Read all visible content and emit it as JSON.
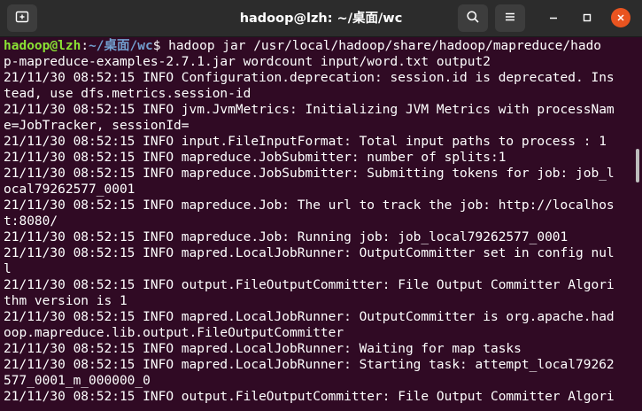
{
  "window": {
    "title": "hadoop@lzh: ~/桌面/wc",
    "icons": {
      "new_tab": "new-tab-icon",
      "search": "search-icon",
      "menu": "hamburger-menu-icon",
      "minimize": "minimize-icon",
      "maximize": "maximize-icon",
      "close": "close-icon"
    }
  },
  "prompt": {
    "user_host": "hadoop@lzh",
    "separator": ":",
    "path": "~/桌面/wc",
    "symbol": "$"
  },
  "command": {
    "first": " hadoop jar /usr/local/hadoop/share/hadoop/mapreduce/hado",
    "continuation": "p-mapreduce-examples-2.7.1.jar wordcount input/word.txt output2"
  },
  "output_lines": [
    "21/11/30 08:52:15 INFO Configuration.deprecation: session.id is deprecated. Ins",
    "tead, use dfs.metrics.session-id",
    "21/11/30 08:52:15 INFO jvm.JvmMetrics: Initializing JVM Metrics with processNam",
    "e=JobTracker, sessionId=",
    "21/11/30 08:52:15 INFO input.FileInputFormat: Total input paths to process : 1",
    "21/11/30 08:52:15 INFO mapreduce.JobSubmitter: number of splits:1",
    "21/11/30 08:52:15 INFO mapreduce.JobSubmitter: Submitting tokens for job: job_l",
    "ocal79262577_0001",
    "21/11/30 08:52:15 INFO mapreduce.Job: The url to track the job: http://localhos",
    "t:8080/",
    "21/11/30 08:52:15 INFO mapreduce.Job: Running job: job_local79262577_0001",
    "21/11/30 08:52:15 INFO mapred.LocalJobRunner: OutputCommitter set in config nul",
    "l",
    "21/11/30 08:52:15 INFO output.FileOutputCommitter: File Output Committer Algori",
    "thm version is 1",
    "21/11/30 08:52:15 INFO mapred.LocalJobRunner: OutputCommitter is org.apache.had",
    "oop.mapreduce.lib.output.FileOutputCommitter",
    "21/11/30 08:52:15 INFO mapred.LocalJobRunner: Waiting for map tasks",
    "21/11/30 08:52:15 INFO mapred.LocalJobRunner: Starting task: attempt_local79262",
    "577_0001_m_000000_0",
    "21/11/30 08:52:15 INFO output.FileOutputCommitter: File Output Committer Algori"
  ],
  "colors": {
    "terminal_background": "#300a24",
    "titlebar_background": "#2c2c2c",
    "prompt_user": "#8ae234",
    "prompt_path": "#729fcf",
    "close_button": "#e95420"
  }
}
